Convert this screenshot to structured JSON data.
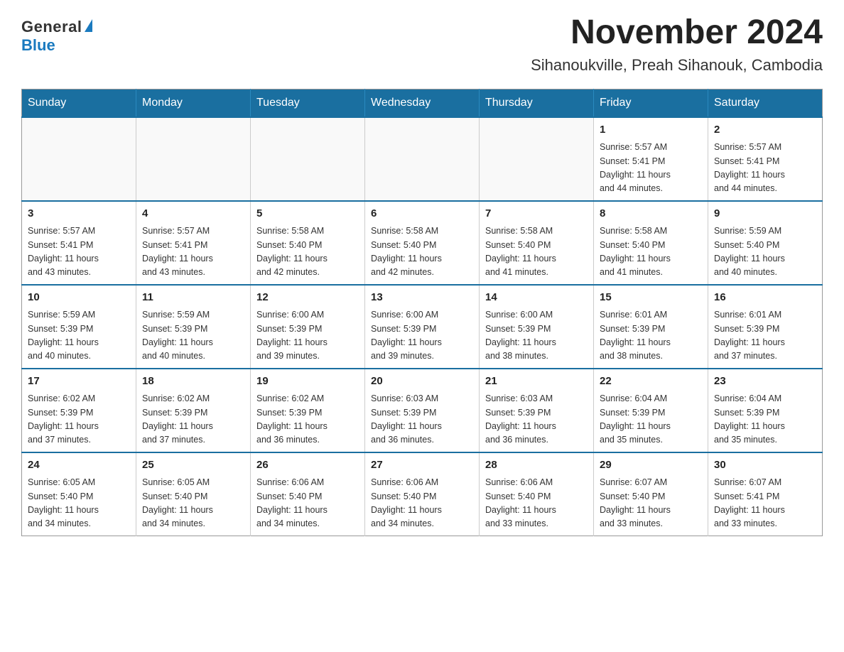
{
  "logo": {
    "general": "General",
    "blue": "Blue"
  },
  "title": "November 2024",
  "subtitle": "Sihanoukville, Preah Sihanouk, Cambodia",
  "days_of_week": [
    "Sunday",
    "Monday",
    "Tuesday",
    "Wednesday",
    "Thursday",
    "Friday",
    "Saturday"
  ],
  "weeks": [
    [
      {
        "day": "",
        "info": ""
      },
      {
        "day": "",
        "info": ""
      },
      {
        "day": "",
        "info": ""
      },
      {
        "day": "",
        "info": ""
      },
      {
        "day": "",
        "info": ""
      },
      {
        "day": "1",
        "info": "Sunrise: 5:57 AM\nSunset: 5:41 PM\nDaylight: 11 hours\nand 44 minutes."
      },
      {
        "day": "2",
        "info": "Sunrise: 5:57 AM\nSunset: 5:41 PM\nDaylight: 11 hours\nand 44 minutes."
      }
    ],
    [
      {
        "day": "3",
        "info": "Sunrise: 5:57 AM\nSunset: 5:41 PM\nDaylight: 11 hours\nand 43 minutes."
      },
      {
        "day": "4",
        "info": "Sunrise: 5:57 AM\nSunset: 5:41 PM\nDaylight: 11 hours\nand 43 minutes."
      },
      {
        "day": "5",
        "info": "Sunrise: 5:58 AM\nSunset: 5:40 PM\nDaylight: 11 hours\nand 42 minutes."
      },
      {
        "day": "6",
        "info": "Sunrise: 5:58 AM\nSunset: 5:40 PM\nDaylight: 11 hours\nand 42 minutes."
      },
      {
        "day": "7",
        "info": "Sunrise: 5:58 AM\nSunset: 5:40 PM\nDaylight: 11 hours\nand 41 minutes."
      },
      {
        "day": "8",
        "info": "Sunrise: 5:58 AM\nSunset: 5:40 PM\nDaylight: 11 hours\nand 41 minutes."
      },
      {
        "day": "9",
        "info": "Sunrise: 5:59 AM\nSunset: 5:40 PM\nDaylight: 11 hours\nand 40 minutes."
      }
    ],
    [
      {
        "day": "10",
        "info": "Sunrise: 5:59 AM\nSunset: 5:39 PM\nDaylight: 11 hours\nand 40 minutes."
      },
      {
        "day": "11",
        "info": "Sunrise: 5:59 AM\nSunset: 5:39 PM\nDaylight: 11 hours\nand 40 minutes."
      },
      {
        "day": "12",
        "info": "Sunrise: 6:00 AM\nSunset: 5:39 PM\nDaylight: 11 hours\nand 39 minutes."
      },
      {
        "day": "13",
        "info": "Sunrise: 6:00 AM\nSunset: 5:39 PM\nDaylight: 11 hours\nand 39 minutes."
      },
      {
        "day": "14",
        "info": "Sunrise: 6:00 AM\nSunset: 5:39 PM\nDaylight: 11 hours\nand 38 minutes."
      },
      {
        "day": "15",
        "info": "Sunrise: 6:01 AM\nSunset: 5:39 PM\nDaylight: 11 hours\nand 38 minutes."
      },
      {
        "day": "16",
        "info": "Sunrise: 6:01 AM\nSunset: 5:39 PM\nDaylight: 11 hours\nand 37 minutes."
      }
    ],
    [
      {
        "day": "17",
        "info": "Sunrise: 6:02 AM\nSunset: 5:39 PM\nDaylight: 11 hours\nand 37 minutes."
      },
      {
        "day": "18",
        "info": "Sunrise: 6:02 AM\nSunset: 5:39 PM\nDaylight: 11 hours\nand 37 minutes."
      },
      {
        "day": "19",
        "info": "Sunrise: 6:02 AM\nSunset: 5:39 PM\nDaylight: 11 hours\nand 36 minutes."
      },
      {
        "day": "20",
        "info": "Sunrise: 6:03 AM\nSunset: 5:39 PM\nDaylight: 11 hours\nand 36 minutes."
      },
      {
        "day": "21",
        "info": "Sunrise: 6:03 AM\nSunset: 5:39 PM\nDaylight: 11 hours\nand 36 minutes."
      },
      {
        "day": "22",
        "info": "Sunrise: 6:04 AM\nSunset: 5:39 PM\nDaylight: 11 hours\nand 35 minutes."
      },
      {
        "day": "23",
        "info": "Sunrise: 6:04 AM\nSunset: 5:39 PM\nDaylight: 11 hours\nand 35 minutes."
      }
    ],
    [
      {
        "day": "24",
        "info": "Sunrise: 6:05 AM\nSunset: 5:40 PM\nDaylight: 11 hours\nand 34 minutes."
      },
      {
        "day": "25",
        "info": "Sunrise: 6:05 AM\nSunset: 5:40 PM\nDaylight: 11 hours\nand 34 minutes."
      },
      {
        "day": "26",
        "info": "Sunrise: 6:06 AM\nSunset: 5:40 PM\nDaylight: 11 hours\nand 34 minutes."
      },
      {
        "day": "27",
        "info": "Sunrise: 6:06 AM\nSunset: 5:40 PM\nDaylight: 11 hours\nand 34 minutes."
      },
      {
        "day": "28",
        "info": "Sunrise: 6:06 AM\nSunset: 5:40 PM\nDaylight: 11 hours\nand 33 minutes."
      },
      {
        "day": "29",
        "info": "Sunrise: 6:07 AM\nSunset: 5:40 PM\nDaylight: 11 hours\nand 33 minutes."
      },
      {
        "day": "30",
        "info": "Sunrise: 6:07 AM\nSunset: 5:41 PM\nDaylight: 11 hours\nand 33 minutes."
      }
    ]
  ]
}
